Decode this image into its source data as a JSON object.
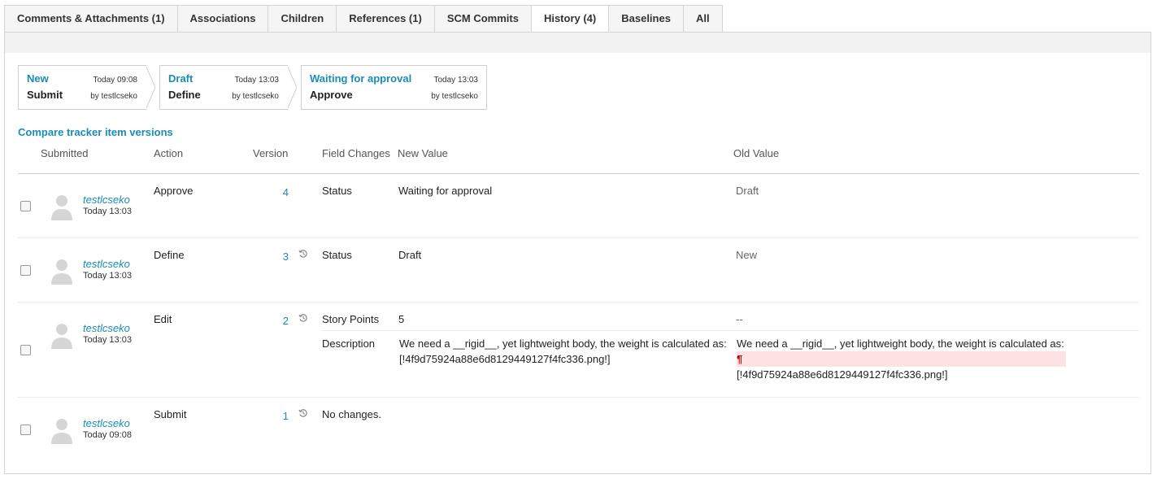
{
  "tabs": [
    {
      "label": "Comments & Attachments (1)"
    },
    {
      "label": "Associations"
    },
    {
      "label": "Children"
    },
    {
      "label": "References (1)"
    },
    {
      "label": "SCM Commits"
    },
    {
      "label": "History (4)"
    },
    {
      "label": "Baselines"
    },
    {
      "label": "All"
    }
  ],
  "workflow": [
    {
      "state": "New",
      "time": "Today 09:08",
      "transition": "Submit",
      "by": "by testlcseko"
    },
    {
      "state": "Draft",
      "time": "Today 13:03",
      "transition": "Define",
      "by": "by testlcseko"
    },
    {
      "state": "Waiting for approval",
      "time": "Today 13:03",
      "transition": "Approve",
      "by": "by testlcseko"
    }
  ],
  "compare_link": "Compare tracker item versions",
  "columns": {
    "submitted": "Submitted",
    "action": "Action",
    "version": "Version",
    "field_changes": "Field Changes",
    "new_value": "New Value",
    "old_value": "Old Value"
  },
  "rows": [
    {
      "user": "testlcseko",
      "time": "Today 13:03",
      "action": "Approve",
      "version": "4",
      "field": "Status",
      "new": "Waiting for approval",
      "old": "Draft"
    },
    {
      "user": "testlcseko",
      "time": "Today 13:03",
      "action": "Define",
      "version": "3",
      "field": "Status",
      "new": "Draft",
      "old": "New"
    },
    {
      "user": "testlcseko",
      "time": "Today 13:03",
      "action": "Edit",
      "version": "2",
      "field": "Story Points",
      "new": "5",
      "old": "--",
      "field2": "Description",
      "new2_line1": "We need a __rigid__, yet lightweight body, the weight is calculated as:",
      "new2_line2": "[!4f9d75924a88e6d8129449127f4fc336.png!]",
      "old2_line1": "We need a __rigid__, yet lightweight body, the weight is calculated as:",
      "old2_deleted": "¶",
      "old2_line2": "[!4f9d75924a88e6d8129449127f4fc336.png!]"
    },
    {
      "user": "testlcseko",
      "time": "Today 09:08",
      "action": "Submit",
      "version": "1",
      "field": "No changes."
    }
  ]
}
